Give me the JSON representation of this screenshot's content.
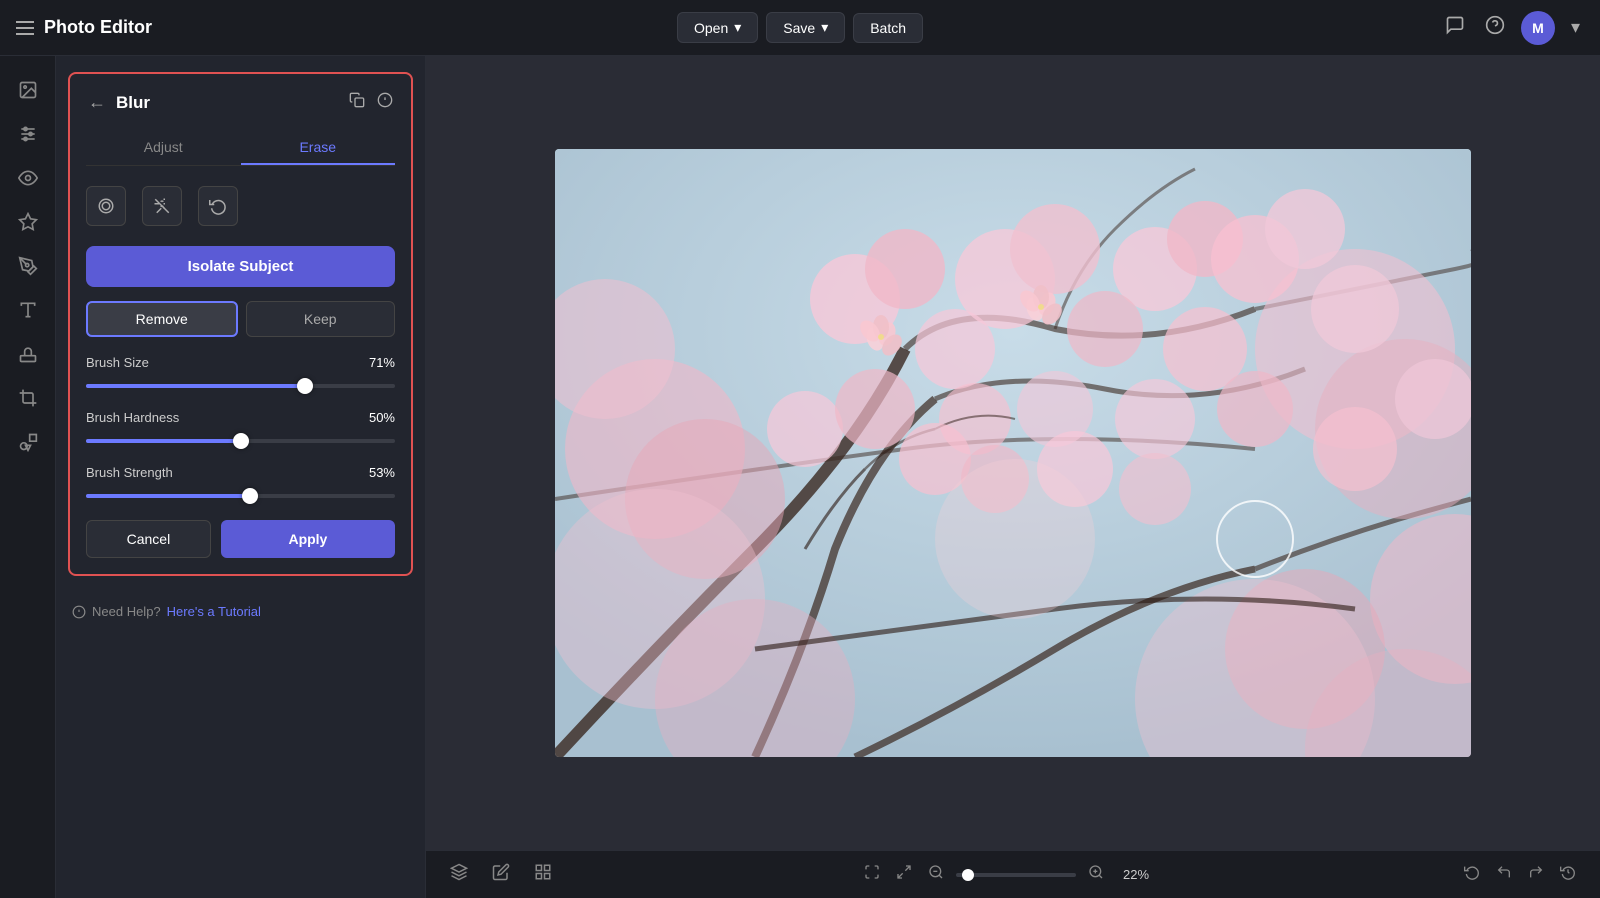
{
  "app": {
    "title": "Photo Editor"
  },
  "topbar": {
    "hamburger_label": "menu",
    "open_label": "Open",
    "open_arrow": "▾",
    "save_label": "Save",
    "save_arrow": "▾",
    "batch_label": "Batch",
    "chat_icon": "💬",
    "help_icon": "?",
    "avatar_label": "M"
  },
  "panel": {
    "back_label": "←",
    "title": "Blur",
    "copy_icon": "⧉",
    "info_icon": "ⓘ",
    "tabs": [
      {
        "id": "adjust",
        "label": "Adjust",
        "active": false
      },
      {
        "id": "erase",
        "label": "Erase",
        "active": true
      }
    ],
    "isolate_subject_label": "Isolate Subject",
    "remove_label": "Remove",
    "keep_label": "Keep",
    "brush_size_label": "Brush Size",
    "brush_size_value": "71%",
    "brush_size_pct": 71,
    "brush_hardness_label": "Brush Hardness",
    "brush_hardness_value": "50%",
    "brush_hardness_pct": 50,
    "brush_strength_label": "Brush Strength",
    "brush_strength_value": "53%",
    "brush_strength_pct": 53,
    "cancel_label": "Cancel",
    "apply_label": "Apply"
  },
  "help": {
    "text": "Need Help?",
    "link_text": "Here's a Tutorial"
  },
  "bottombar": {
    "zoom_value": "22%",
    "zoom_pct": 22
  }
}
